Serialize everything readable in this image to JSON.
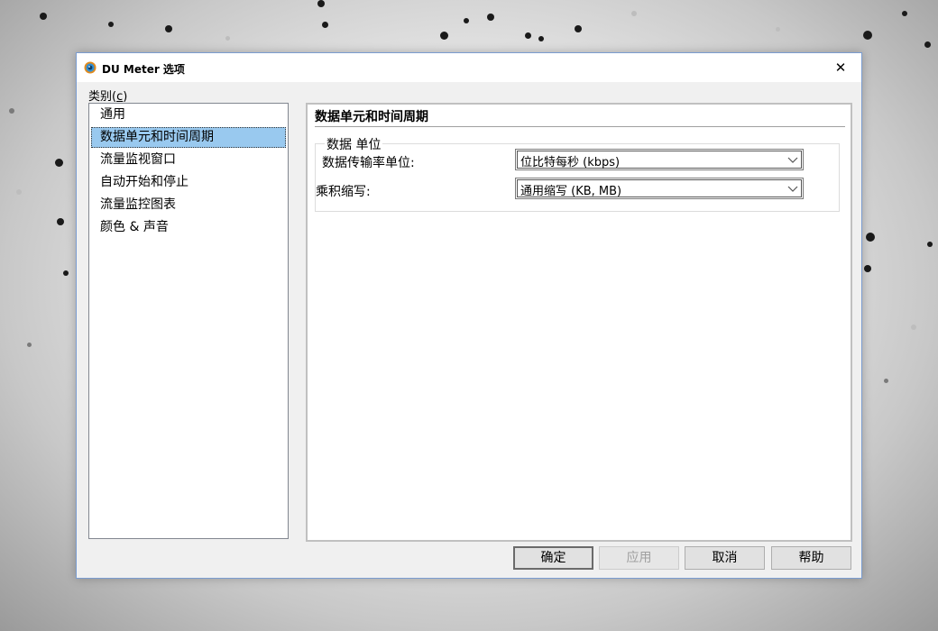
{
  "window": {
    "title": "DU Meter 选项",
    "close_glyph": "✕"
  },
  "category": {
    "label": "类别(",
    "hotkey": "c",
    "label_end": ")",
    "items": [
      {
        "label": "通用"
      },
      {
        "label": "数据单元和时间周期"
      },
      {
        "label": "流量监视窗口"
      },
      {
        "label": "自动开始和停止"
      },
      {
        "label": "流量监控图表"
      },
      {
        "label": "颜色 & 声音"
      }
    ],
    "selected_index": 1
  },
  "panel": {
    "title": "数据单元和时间周期",
    "group": {
      "legend": "数据 单位",
      "rate_label": "数据传输率单位:",
      "rate_value": "位比特每秒 (kbps)",
      "multiplier_label": "乘积缩写:",
      "multiplier_value": "通用缩写 (KB, MB)"
    }
  },
  "buttons": {
    "ok": "确定",
    "apply": "应用",
    "cancel": "取消",
    "help": "帮助"
  },
  "colors": {
    "selection": "#99c9ef",
    "window_border": "#7a9cd0",
    "dialog_bg": "#f0f0f0"
  },
  "icons": {
    "app": "du-meter-icon",
    "close": "close-icon",
    "dropdown": "chevron-down-icon"
  }
}
